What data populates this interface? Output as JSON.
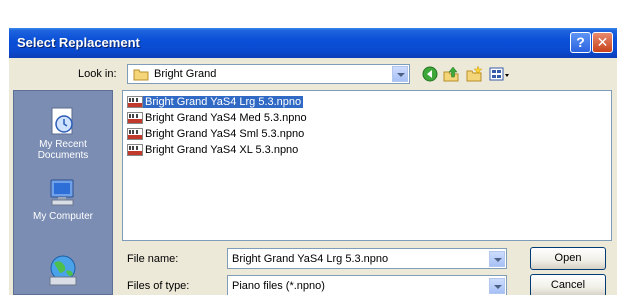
{
  "dialog": {
    "title": "Select Replacement",
    "help_glyph": "?",
    "close_glyph": "✕"
  },
  "look_in": {
    "label": "Look in:",
    "value": "Bright Grand"
  },
  "places": [
    {
      "label": "My Recent Documents",
      "icon": "recent-documents-icon"
    },
    {
      "label": "My Computer",
      "icon": "computer-icon"
    },
    {
      "label": "",
      "icon": "network-places-icon"
    }
  ],
  "files": [
    {
      "name": "Bright Grand YaS4  Lrg 5.3.npno",
      "selected": true
    },
    {
      "name": "Bright Grand YaS4  Med 5.3.npno",
      "selected": false
    },
    {
      "name": "Bright Grand YaS4  Sml 5.3.npno",
      "selected": false
    },
    {
      "name": "Bright Grand YaS4  XL 5.3.npno",
      "selected": false
    }
  ],
  "file_name": {
    "label": "File name:",
    "value": "Bright Grand YaS4  Lrg 5.3.npno"
  },
  "file_type": {
    "label": "Files of type:",
    "value": "Piano files (*.npno)"
  },
  "buttons": {
    "open": "Open",
    "cancel": "Cancel"
  },
  "colors": {
    "titlebar": "#0a50d8",
    "dialog_bg": "#ece9d8",
    "places_bar": "#7b8db3",
    "selection": "#316ac5"
  }
}
